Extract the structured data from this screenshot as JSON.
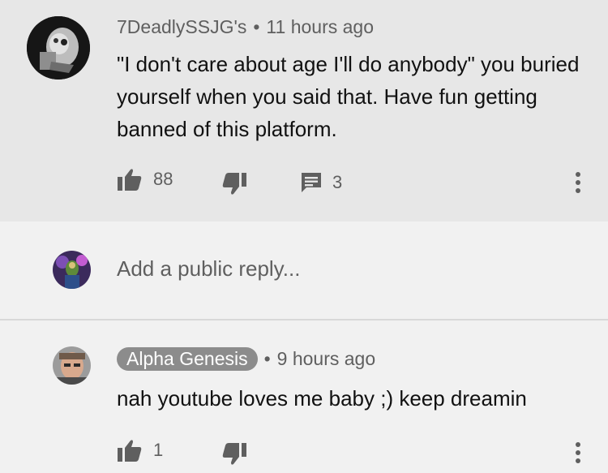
{
  "comment": {
    "author": "7DeadlySSJG's",
    "separator": "•",
    "time": "11 hours ago",
    "text": "\"I don't care about age I'll do anybody\" you buried yourself when you said that. Have fun getting banned of this platform.",
    "like_count": "88",
    "reply_count": "3"
  },
  "reply_input": {
    "placeholder": "Add a public reply..."
  },
  "reply": {
    "author": "Alpha Genesis",
    "separator": "•",
    "time": "9 hours ago",
    "text": "nah youtube loves me baby ;) keep dreamin",
    "like_count": "1"
  },
  "icons": {
    "like": "thumbs-up-icon",
    "dislike": "thumbs-down-icon",
    "replies": "comment-icon",
    "menu": "more-vert-icon"
  }
}
